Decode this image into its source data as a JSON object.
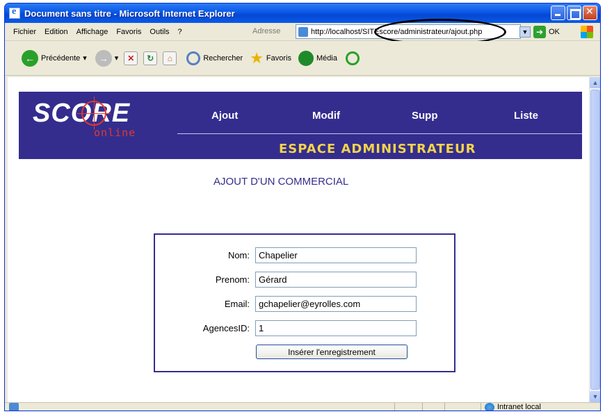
{
  "window": {
    "title": "Document sans titre - Microsoft Internet Explorer"
  },
  "menu": [
    "Fichier",
    "Edition",
    "Affichage",
    "Favoris",
    "Outils",
    "?"
  ],
  "address": {
    "label": "Adresse",
    "url": "http://localhost/SITEscore/administrateur/ajout.php",
    "go_label": "OK"
  },
  "toolbar": {
    "back_label": "Précédente",
    "search_label": "Rechercher",
    "favorites_label": "Favoris",
    "media_label": "Média"
  },
  "site": {
    "logo_main": "SCORE",
    "logo_sub": "online",
    "nav": [
      "Ajout",
      "Modif",
      "Supp",
      "Liste"
    ],
    "section_title": "ESPACE ADMINISTRATEUR"
  },
  "form": {
    "heading": "AJOUT D'UN COMMERCIAL",
    "fields": [
      {
        "label": "Nom:",
        "value": "Chapelier"
      },
      {
        "label": "Prenom:",
        "value": "Gérard"
      },
      {
        "label": "Email:",
        "value": "gchapelier@eyrolles.com"
      },
      {
        "label": "AgencesID:",
        "value": "1"
      }
    ],
    "submit_label": "Insérer l'enregistrement"
  },
  "status": {
    "zone_label": "Intranet local"
  },
  "colors": {
    "header_bg": "#342d8e",
    "section_title": "#f3d44a",
    "logo_accent": "#e03a2e"
  }
}
